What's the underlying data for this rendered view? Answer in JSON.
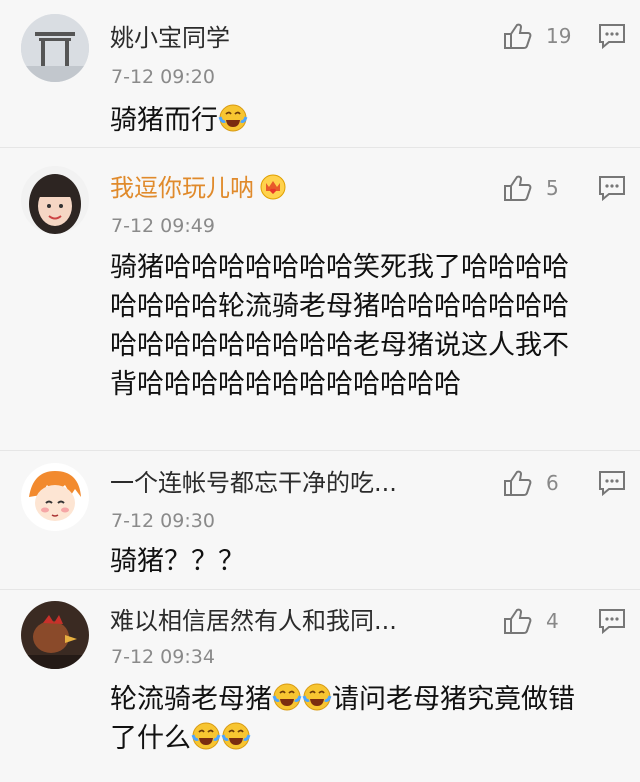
{
  "comments": [
    {
      "name": "姚小宝同学",
      "likes": "19",
      "time": "7-12 09:20",
      "text": "骑猪而行",
      "text_emoji": "laughing-crying-emoji"
    },
    {
      "name": "我逗你玩儿呐",
      "likes": "5",
      "time": "7-12 09:49",
      "text": "骑猪哈哈哈哈哈哈哈笑死我了哈哈哈哈哈哈哈哈轮流骑老母猪哈哈哈哈哈哈哈哈哈哈哈哈哈哈哈哈老母猪说这人我不背哈哈哈哈哈哈哈哈哈哈哈哈",
      "badge": "crown-heart-badge"
    },
    {
      "name": "一个连帐号都忘干净的吃...",
      "likes": "6",
      "time": "7-12 09:30",
      "text": "骑猪？？？"
    },
    {
      "name": "难以相信居然有人和我同...",
      "likes": "4",
      "time": "7-12 09:34",
      "text_part1": "轮流骑老母猪",
      "text_part2": "请问老母猪究竟做错了什么"
    }
  ],
  "colors": {
    "name_vip": "#e08a2b",
    "meta": "#8a8a8a",
    "divider": "#e6e6e6",
    "background": "#f7f7f7"
  }
}
